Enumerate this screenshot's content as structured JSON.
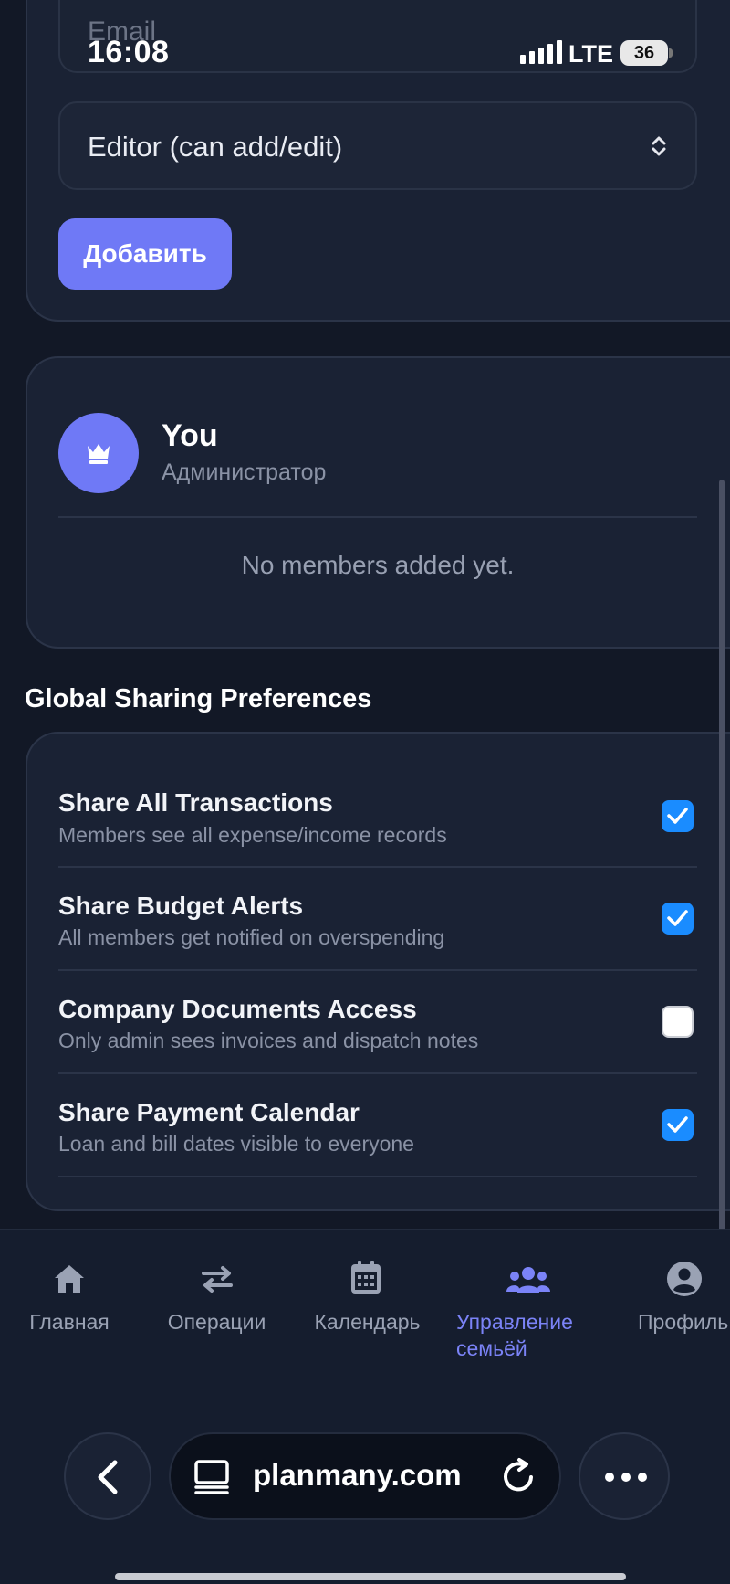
{
  "status_bar": {
    "time": "16:08",
    "network": "LTE",
    "battery": "36"
  },
  "invite_form": {
    "email_placeholder": "Email",
    "role_value": "Editor (can add/edit)",
    "add_button": "Добавить"
  },
  "members": {
    "owner_name": "You",
    "owner_role": "Администратор",
    "empty_message": "No members added yet."
  },
  "preferences": {
    "title": "Global Sharing Preferences",
    "items": [
      {
        "title": "Share All Transactions",
        "subtitle": "Members see all expense/income records",
        "checked": true
      },
      {
        "title": "Share Budget Alerts",
        "subtitle": "All members get notified on overspending",
        "checked": true
      },
      {
        "title": "Company Documents Access",
        "subtitle": "Only admin sees invoices and dispatch notes",
        "checked": false
      },
      {
        "title": "Share Payment Calendar",
        "subtitle": "Loan and bill dates visible to everyone",
        "checked": true
      }
    ]
  },
  "bottom_nav": {
    "items": [
      {
        "label": "Главная",
        "icon": "home-icon",
        "active": false
      },
      {
        "label": "Операции",
        "icon": "swap-arrows-icon",
        "active": false
      },
      {
        "label": "Календарь",
        "icon": "calendar-icon",
        "active": false
      },
      {
        "label": "Управление семьёй",
        "icon": "users-icon",
        "active": true
      },
      {
        "label": "Профиль",
        "icon": "user-circle-icon",
        "active": false
      }
    ]
  },
  "browser": {
    "url": "planmany.com"
  },
  "colors": {
    "accent": "#6f79f6",
    "checkbox": "#1a8cff",
    "background": "#121826",
    "card": "#1a2234"
  }
}
